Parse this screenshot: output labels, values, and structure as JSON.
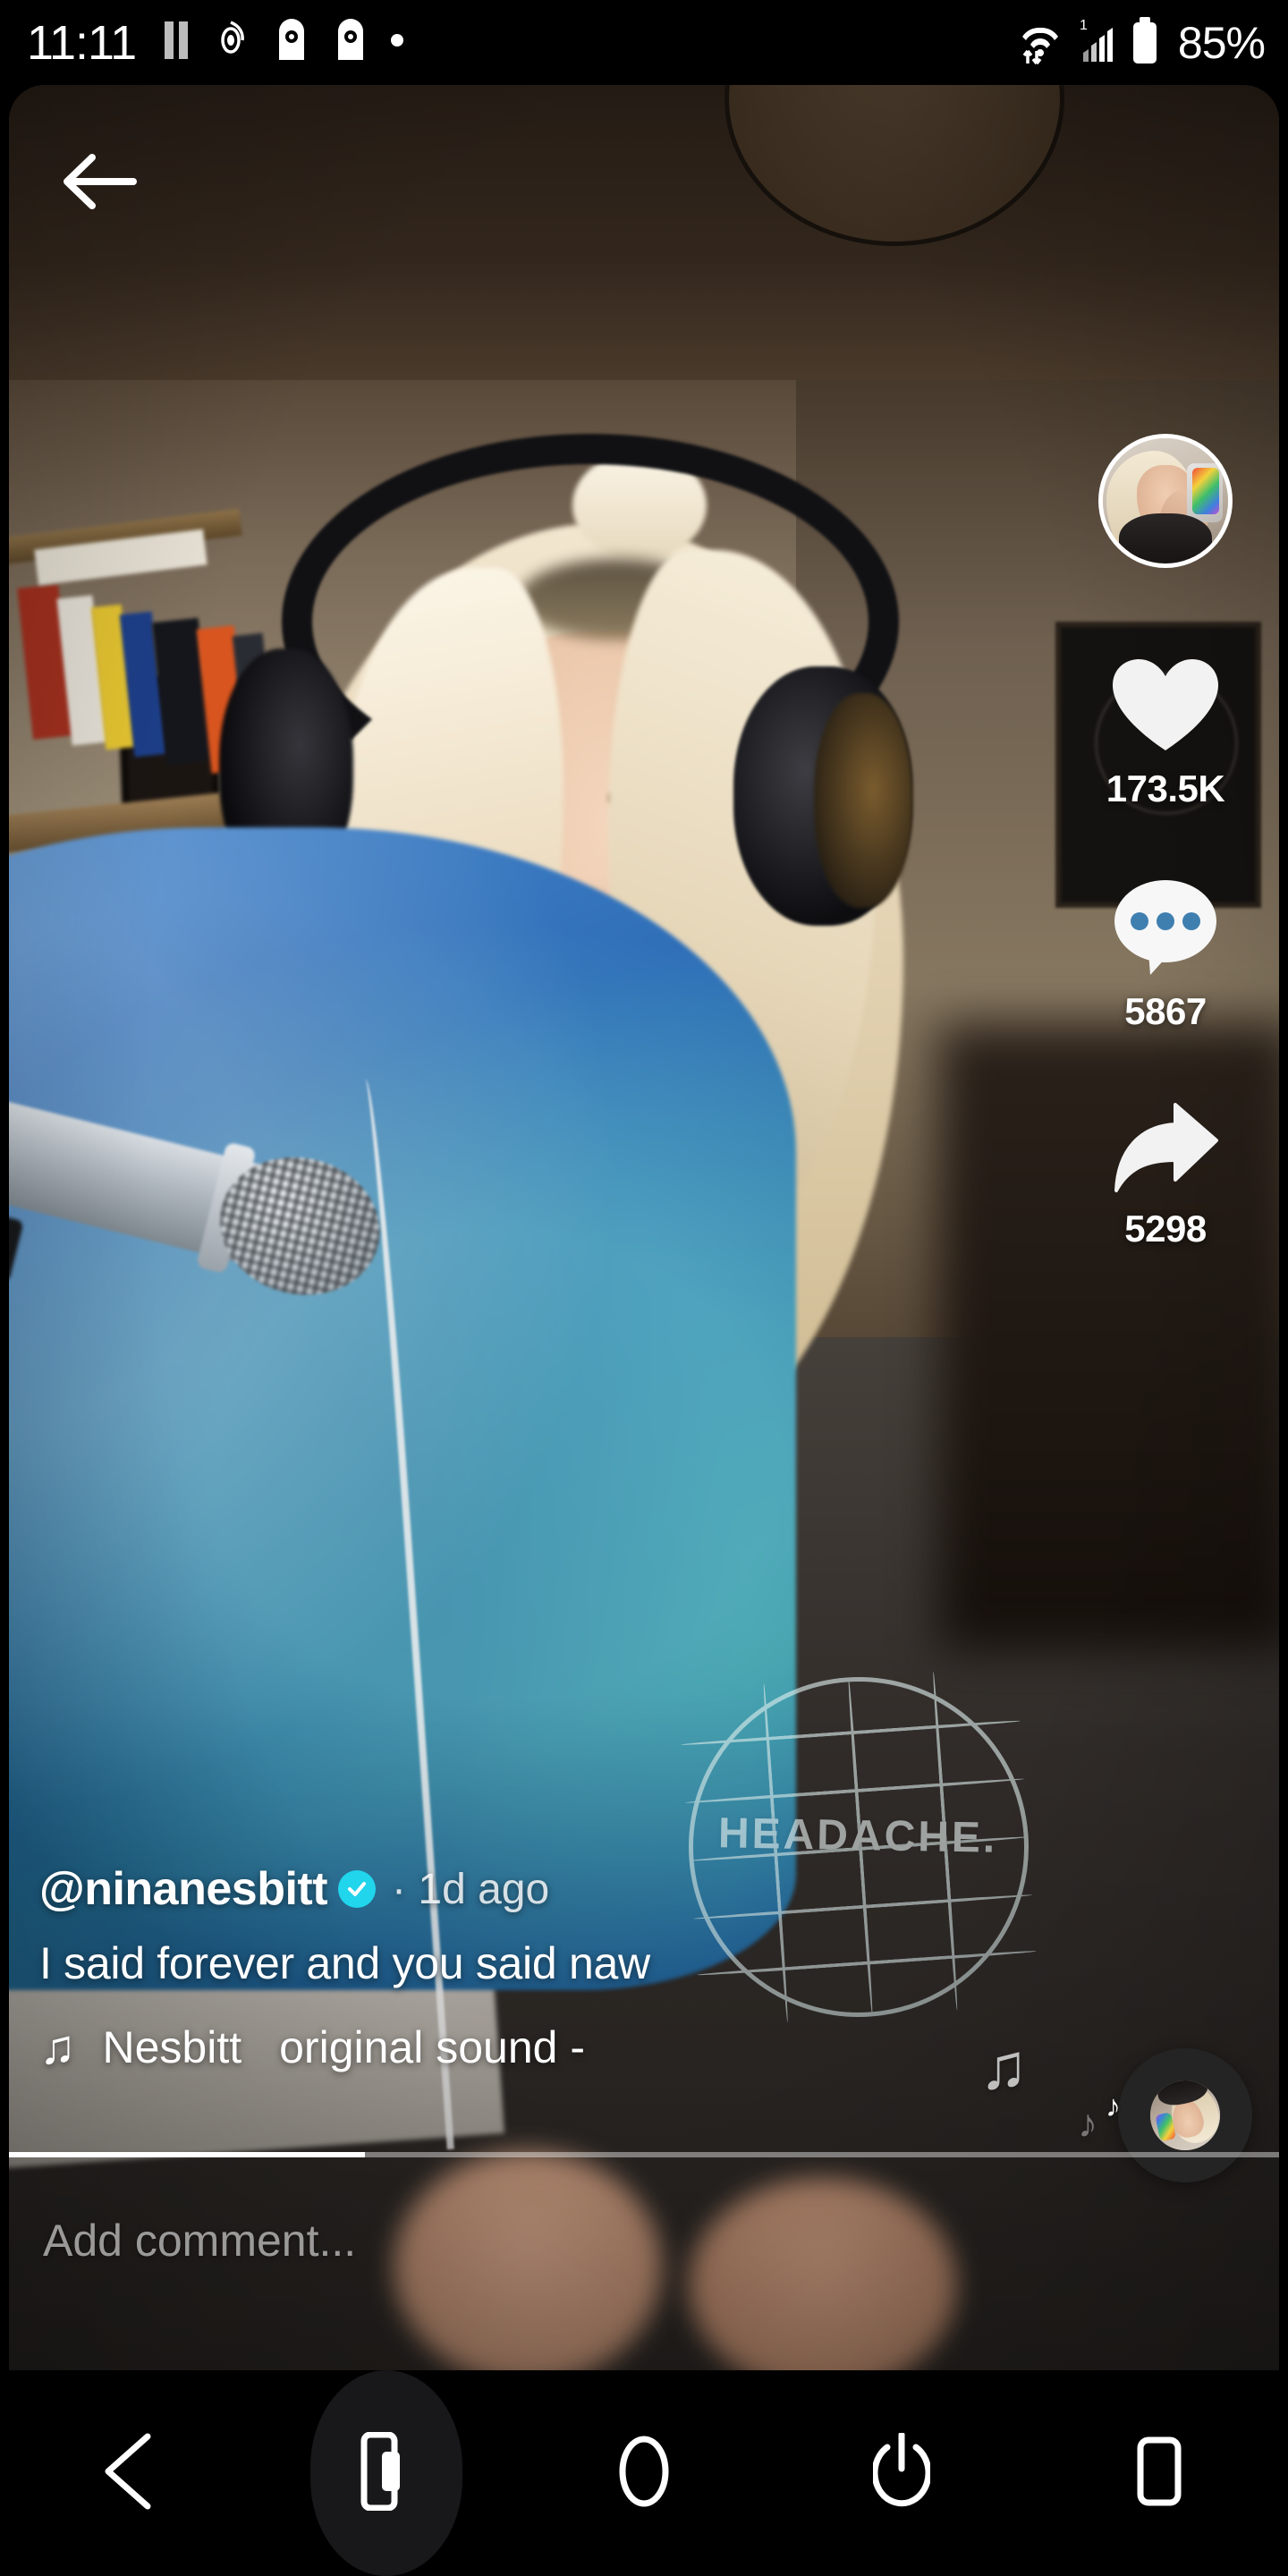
{
  "status_bar": {
    "time": "11:11",
    "battery": "85%",
    "icons_left": [
      "pause-icon",
      "spiral-notification-icon",
      "app-notification-icon",
      "app-notification-icon-2",
      "dot-icon"
    ],
    "icons_right": [
      "wifi-icon",
      "signal-icon",
      "battery-icon"
    ]
  },
  "video": {
    "back_button": "back-arrow-icon",
    "shirt_graphic_text": "HEADACHE.",
    "progress_percent": 28
  },
  "actions": {
    "avatar": "creator-avatar",
    "like": {
      "icon": "heart-icon",
      "count": "173.5K"
    },
    "comment": {
      "icon": "comment-bubble-icon",
      "count": "5867"
    },
    "share": {
      "icon": "share-arrow-icon",
      "count": "5298"
    },
    "music_disc": "spinning-music-disc"
  },
  "caption": {
    "author": "@ninanesbitt",
    "verified": true,
    "separator": "·",
    "time_ago": "1d ago",
    "text": "I said forever and you said naw",
    "music_note": "♫",
    "music_title": "Nesbitt",
    "music_subtitle": "original sound -"
  },
  "comment_bar": {
    "placeholder": "Add comment..."
  },
  "nav_bar": {
    "items": [
      {
        "name": "back",
        "icon": "triangle-back-icon"
      },
      {
        "name": "device",
        "icon": "phone-device-icon",
        "active": true
      },
      {
        "name": "home",
        "icon": "circle-home-icon"
      },
      {
        "name": "power",
        "icon": "power-icon"
      },
      {
        "name": "recents",
        "icon": "square-recents-icon"
      }
    ]
  },
  "colors": {
    "accent_verified": "#20d5ec",
    "text_primary": "#ffffff",
    "nav_background": "#000000"
  }
}
